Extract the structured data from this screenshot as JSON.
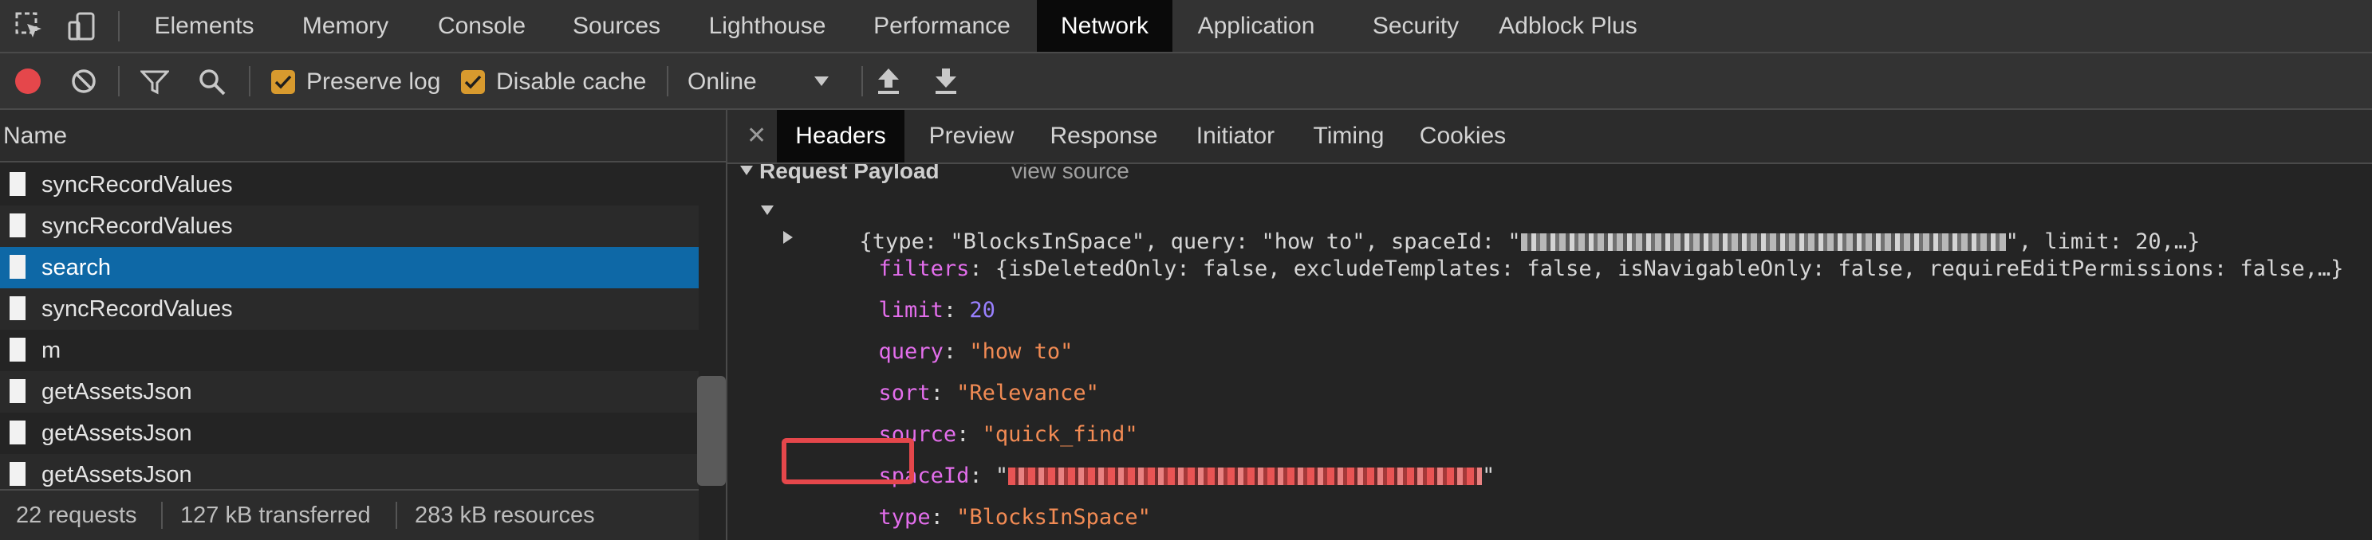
{
  "tabs": [
    "Elements",
    "Memory",
    "Console",
    "Sources",
    "Lighthouse",
    "Performance",
    "Network",
    "Application",
    "Security",
    "Adblock Plus"
  ],
  "active_tab": "Network",
  "toolbar": {
    "preserve_log": "Preserve log",
    "disable_cache": "Disable cache",
    "throttle": "Online"
  },
  "request_list": {
    "column_header": "Name",
    "rows": [
      "syncRecordValues",
      "syncRecordValues",
      "search",
      "syncRecordValues",
      "m",
      "getAssetsJson",
      "getAssetsJson",
      "getAssetsJson"
    ],
    "selected_index": 2
  },
  "status": {
    "requests": "22 requests",
    "transferred": "127 kB transferred",
    "resources": "283 kB resources"
  },
  "detail_tabs": [
    "Headers",
    "Preview",
    "Response",
    "Initiator",
    "Timing",
    "Cookies"
  ],
  "active_detail_tab": "Headers",
  "payload": {
    "section": "Request Payload",
    "view_source": "view source",
    "summary_prefix": "{type: \"BlocksInSpace\", query: \"how to\", spaceId: \"",
    "summary_suffix": "\", limit: 20,…}",
    "filters_key": "filters",
    "filters_value": "{isDeletedOnly: false, excludeTemplates: false, isNavigableOnly: false, requireEditPermissions: false,…}",
    "limit_key": "limit",
    "limit_value": "20",
    "query_key": "query",
    "query_value": "\"how to\"",
    "sort_key": "sort",
    "sort_value": "\"Relevance\"",
    "source_key": "source",
    "source_value": "\"quick_find\"",
    "spaceid_key": "spaceId",
    "quote": "\"",
    "type_key": "type",
    "type_value": "\"BlocksInSpace\""
  },
  "colors": {
    "accent_selected": "#0e68a6",
    "checkbox": "#d89a2e",
    "highlight": "#e5474b",
    "record": "#e5474b"
  },
  "icons": [
    "inspect-icon",
    "device-toolbar-icon",
    "record-icon",
    "clear-icon",
    "filter-icon",
    "search-icon",
    "dropdown-arrow-icon",
    "upload-icon",
    "download-icon",
    "close-icon",
    "expand-triangle-icon"
  ]
}
